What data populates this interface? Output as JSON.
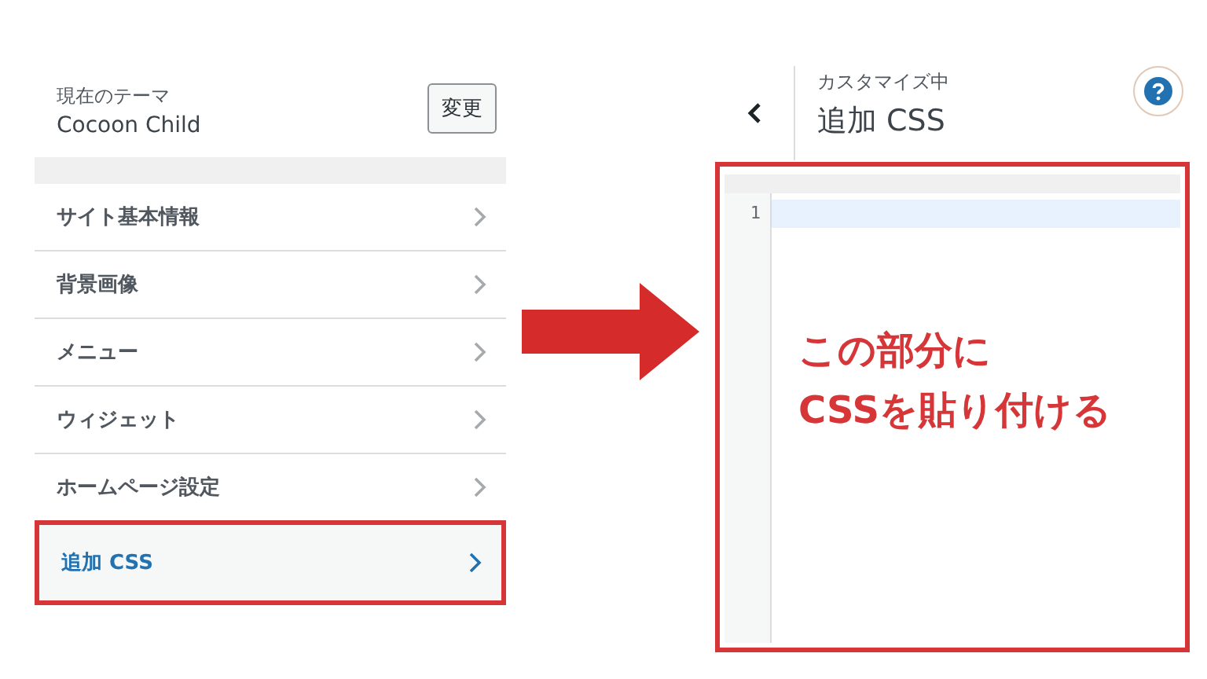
{
  "theme_panel": {
    "caption": "現在のテーマ",
    "theme_name": "Cocoon Child",
    "change_button": "変更"
  },
  "menu_items": [
    {
      "label": "サイト基本情報",
      "selected": false
    },
    {
      "label": "背景画像",
      "selected": false
    },
    {
      "label": "メニュー",
      "selected": false
    },
    {
      "label": "ウィジェット",
      "selected": false
    },
    {
      "label": "ホームページ設定",
      "selected": false
    },
    {
      "label": "追加 CSS",
      "selected": true
    }
  ],
  "css_panel": {
    "caption": "カスタマイズ中",
    "title": "追加 CSS",
    "line_numbers": [
      "1"
    ]
  },
  "annotation": {
    "lines": [
      "この部分に",
      "CSSを貼り付ける"
    ]
  }
}
